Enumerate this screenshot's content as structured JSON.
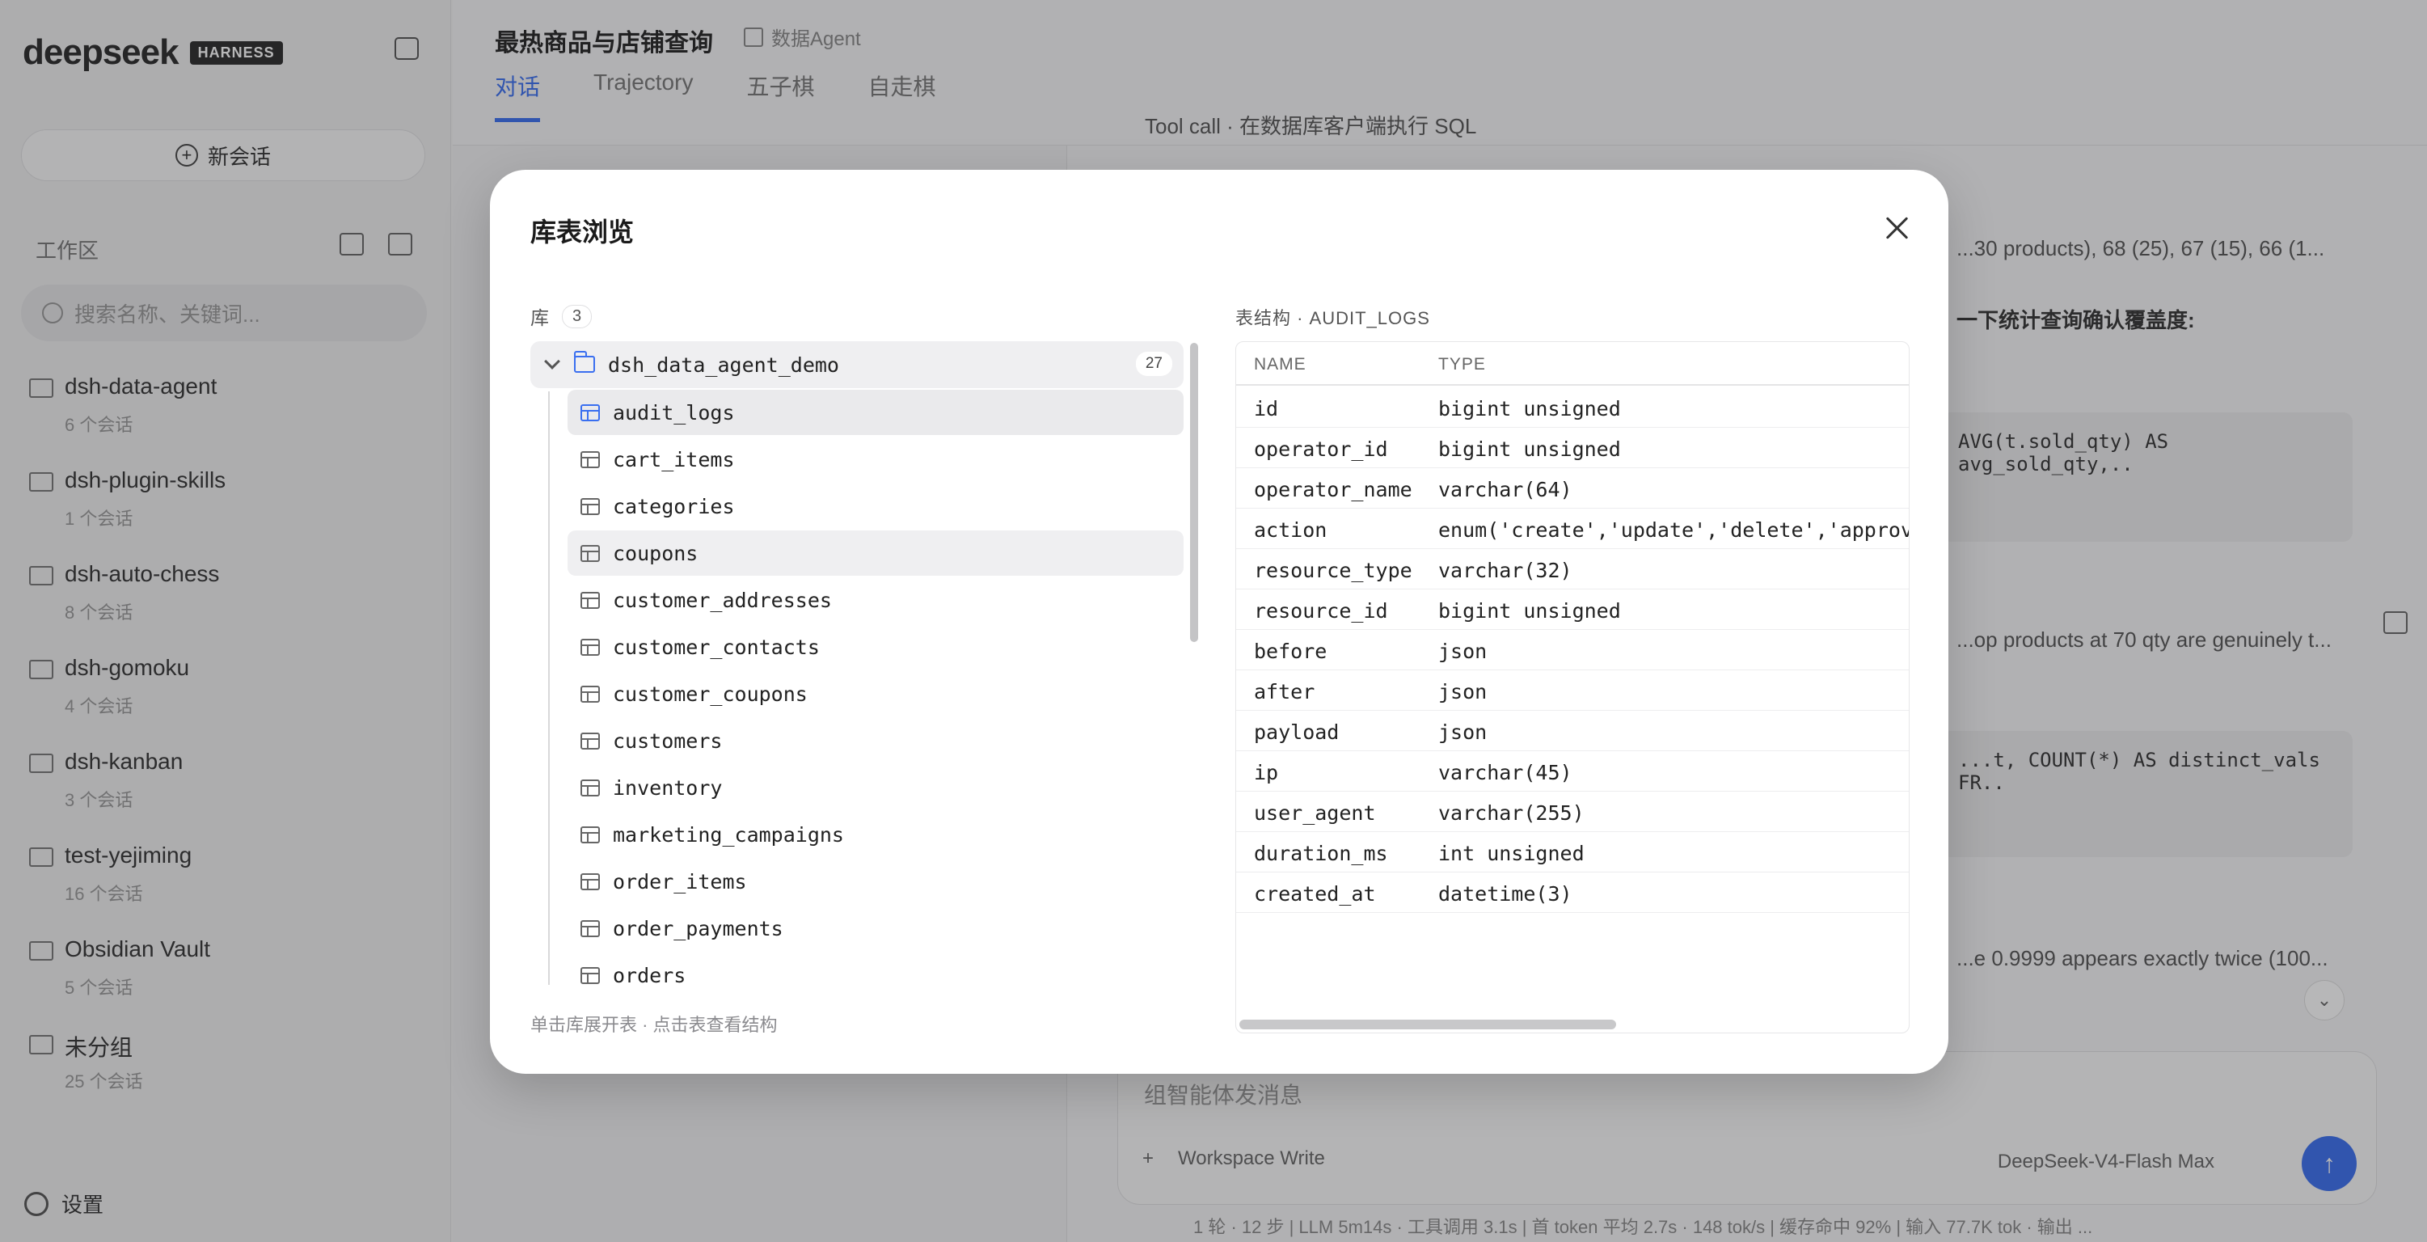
{
  "sidebar": {
    "brand": "deepseek",
    "badge": "HARNESS",
    "new_chat": "新会话",
    "workspace_label": "工作区",
    "search_placeholder": "搜索名称、关键词...",
    "workspaces": [
      {
        "name": "dsh-data-agent",
        "sub": "6 个会话"
      },
      {
        "name": "dsh-plugin-skills",
        "sub": "1 个会话"
      },
      {
        "name": "dsh-auto-chess",
        "sub": "8 个会话"
      },
      {
        "name": "dsh-gomoku",
        "sub": "4 个会话"
      },
      {
        "name": "dsh-kanban",
        "sub": "3 个会话"
      },
      {
        "name": "test-yejiming",
        "sub": "16 个会话"
      },
      {
        "name": "Obsidian Vault",
        "sub": "5 个会话"
      },
      {
        "name": "未分组",
        "sub": "25 个会话"
      }
    ],
    "settings": "设置"
  },
  "header": {
    "title": "最热商品与店铺查询",
    "agent": "数据Agent",
    "tabs": [
      "对话",
      "Trajectory",
      "五子棋",
      "自走棋"
    ]
  },
  "chat": {
    "tool_call": "Tool call · 在数据库客户端执行 SQL",
    "line1": "...30 products), 68 (25), 67 (15), 66 (1...",
    "line2": "一下统计查询确认覆盖度:",
    "code1": "AVG(t.sold_qty) AS avg_sold_qty,..",
    "line3": "...op products at 70 qty are genuinely t...",
    "code2": "...t, COUNT(*) AS distinct_vals FR..",
    "line4": "...e 0.9999 appears exactly twice (100...",
    "input_placeholder": "组智能体发消息",
    "workspace_mode": "Workspace Write",
    "model": "DeepSeek-V4-Flash",
    "model_level": "Max",
    "status": "1 轮 · 12 步  |  LLM 5m14s · 工具调用 3.1s  |  首 token 平均 2.7s · 148 tok/s  |  缓存命中 92%  |  输入 77.7K tok · 输出 ..."
  },
  "modal": {
    "title": "库表浏览",
    "db_label": "库",
    "db_count": "3",
    "database": {
      "name": "dsh_data_agent_demo",
      "table_count": "27"
    },
    "tables": [
      "audit_logs",
      "cart_items",
      "categories",
      "coupons",
      "customer_addresses",
      "customer_contacts",
      "customer_coupons",
      "customers",
      "inventory",
      "marketing_campaigns",
      "order_items",
      "order_payments",
      "orders"
    ],
    "hint": "单击库展开表 · 点击表查看结构",
    "structure_title": "表结构 · AUDIT_LOGS",
    "columns_header": {
      "name": "NAME",
      "type": "TYPE"
    },
    "columns": [
      {
        "name": "id",
        "type": "bigint unsigned"
      },
      {
        "name": "operator_id",
        "type": "bigint unsigned"
      },
      {
        "name": "operator_name",
        "type": "varchar(64)"
      },
      {
        "name": "action",
        "type": "enum('create','update','delete','approve"
      },
      {
        "name": "resource_type",
        "type": "varchar(32)"
      },
      {
        "name": "resource_id",
        "type": "bigint unsigned"
      },
      {
        "name": "before",
        "type": "json"
      },
      {
        "name": "after",
        "type": "json"
      },
      {
        "name": "payload",
        "type": "json"
      },
      {
        "name": "ip",
        "type": "varchar(45)"
      },
      {
        "name": "user_agent",
        "type": "varchar(255)"
      },
      {
        "name": "duration_ms",
        "type": "int unsigned"
      },
      {
        "name": "created_at",
        "type": "datetime(3)"
      }
    ]
  }
}
